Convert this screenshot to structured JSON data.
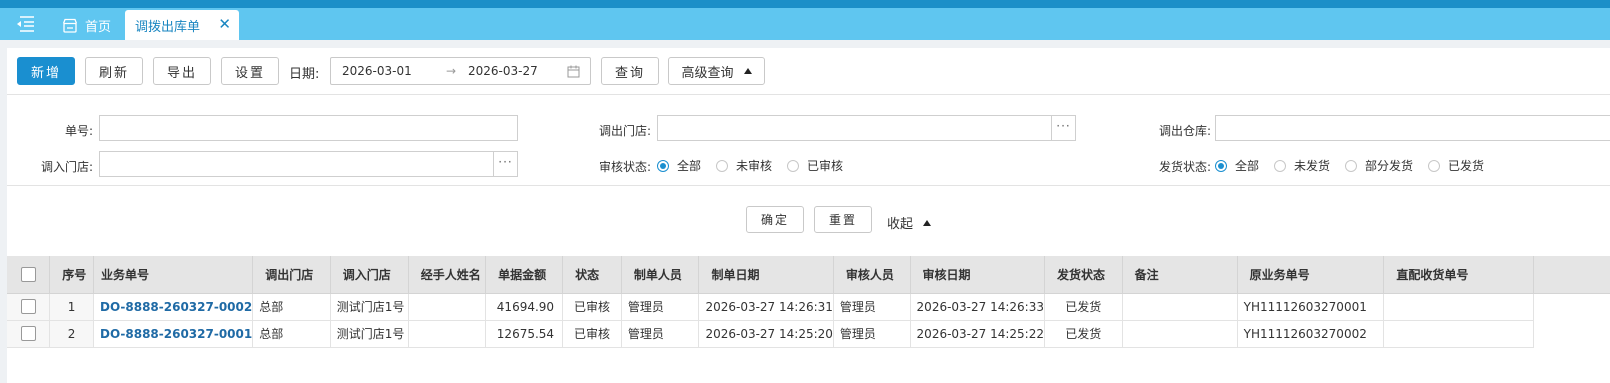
{
  "tabs": {
    "home_label": "首页",
    "active_label": "调拨出库单"
  },
  "toolbar": {
    "new_label": "新增",
    "refresh_label": "刷新",
    "export_label": "导出",
    "settings_label": "设置",
    "date_label": "日期:",
    "date_start": "2026-03-01",
    "date_end": "2026-03-27",
    "query_label": "查询",
    "advanced_label": "高级查询"
  },
  "filters": {
    "doc_no_label": "单号:",
    "out_store_label": "调出门店:",
    "out_warehouse_label": "调出仓库:",
    "in_store_label": "调入门店:",
    "audit_label": "审核状态:",
    "audit_options": [
      "全部",
      "未审核",
      "已审核"
    ],
    "ship_label": "发货状态:",
    "ship_options": [
      "全部",
      "未发货",
      "部分发货",
      "已发货"
    ],
    "confirm_label": "确定",
    "reset_label": "重置",
    "collapse_label": "收起"
  },
  "table": {
    "columns": [
      "序号",
      "业务单号",
      "调出门店",
      "调入门店",
      "经手人姓名",
      "单据金额",
      "状态",
      "制单人员",
      "制单日期",
      "审核人员",
      "审核日期",
      "发货状态",
      "备注",
      "原业务单号",
      "直配收货单号"
    ],
    "rows": [
      {
        "seq": "1",
        "doc_no": "DO-8888-260327-0002",
        "out_store": "总部",
        "in_store": "测试门店1号",
        "handler": "",
        "amount": "41694.90",
        "status": "已审核",
        "creator": "管理员",
        "created": "2026-03-27 14:26:31",
        "auditor": "管理员",
        "audited": "2026-03-27 14:26:33",
        "ship": "已发货",
        "note": "",
        "orig_no": "YH11112603270001",
        "direct_no": ""
      },
      {
        "seq": "2",
        "doc_no": "DO-8888-260327-0001",
        "out_store": "总部",
        "in_store": "测试门店1号",
        "handler": "",
        "amount": "12675.54",
        "status": "已审核",
        "creator": "管理员",
        "created": "2026-03-27 14:25:20",
        "auditor": "管理员",
        "audited": "2026-03-27 14:25:22",
        "ship": "已发货",
        "note": "",
        "orig_no": "YH11112603270002",
        "direct_no": ""
      }
    ]
  },
  "colors": {
    "topbar": "#1b8fc8",
    "tabbar": "#5fc6f0",
    "primary": "#1a8fd0",
    "link": "#1f6aa5"
  }
}
